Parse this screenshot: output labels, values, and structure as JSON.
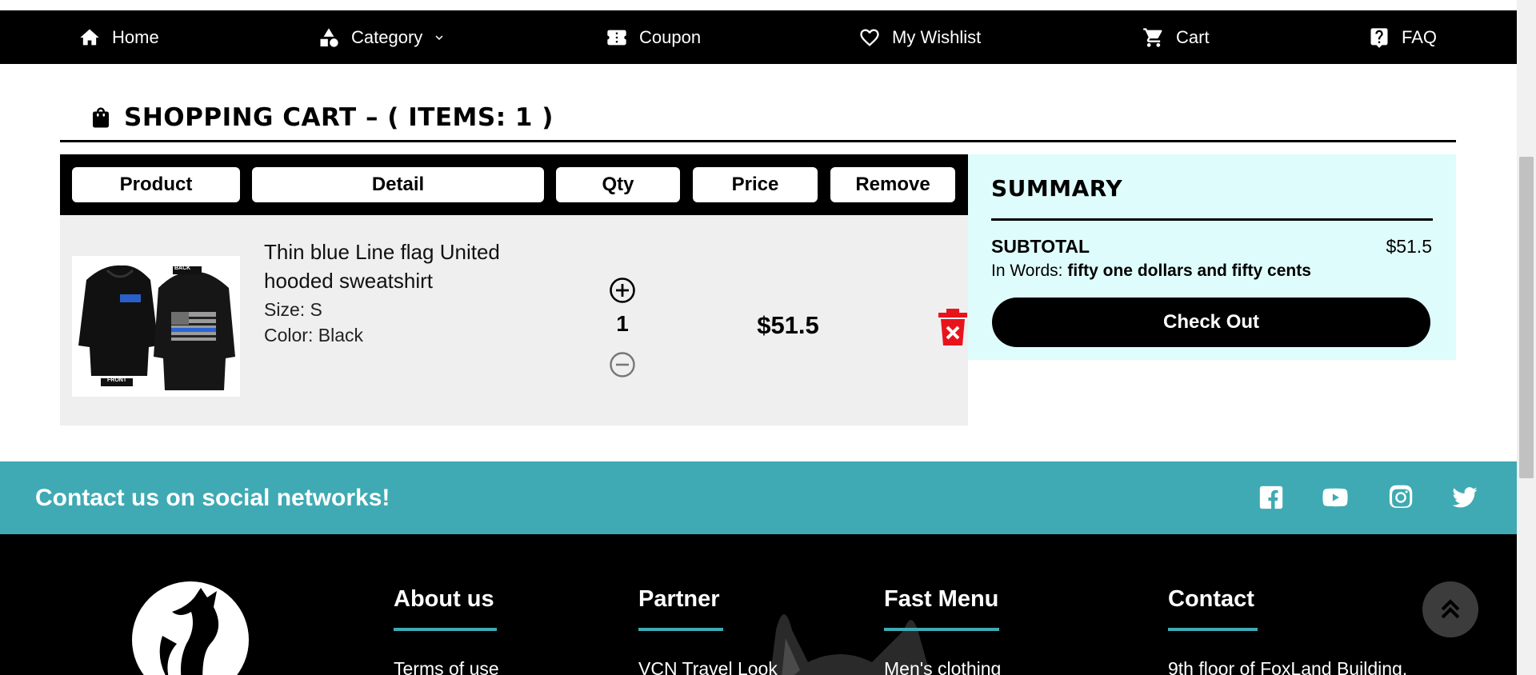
{
  "nav": {
    "home": "Home",
    "category": "Category",
    "coupon": "Coupon",
    "wishlist": "My Wishlist",
    "cart": "Cart",
    "faq": "FAQ"
  },
  "cart": {
    "heading": "SHOPPING CART – ( ITEMS: 1 )",
    "columns": [
      "Product",
      "Detail",
      "Qty",
      "Price",
      "Remove"
    ],
    "item": {
      "title": "Thin blue Line flag United hooded sweatshirt",
      "size": "Size: S",
      "color": "Color: Black",
      "qty": "1",
      "price": "$51.5",
      "image_labels": {
        "back": "BACK",
        "front": "FRONT"
      }
    }
  },
  "summary": {
    "title": "SUMMARY",
    "subtotal_label": "SUBTOTAL",
    "subtotal_value": "$51.5",
    "in_words_label": "In Words:",
    "in_words_value": "fifty one dollars and fifty cents",
    "checkout": "Check Out"
  },
  "social": {
    "text": "Contact us on social networks!",
    "icons": [
      "facebook-icon",
      "youtube-icon",
      "instagram-icon",
      "twitter-icon"
    ]
  },
  "footer": {
    "columns": [
      {
        "title": "About us",
        "link": "Terms of use"
      },
      {
        "title": "Partner",
        "link": "VCN Travel Look"
      },
      {
        "title": "Fast Menu",
        "link": "Men's clothing"
      },
      {
        "title": "Contact",
        "link": "9th floor of FoxLand Building,"
      }
    ]
  },
  "colors": {
    "accent": "#3faab3",
    "summary_bg": "#dffcfc",
    "row_bg": "#efefef",
    "remove": "#e8141c"
  }
}
